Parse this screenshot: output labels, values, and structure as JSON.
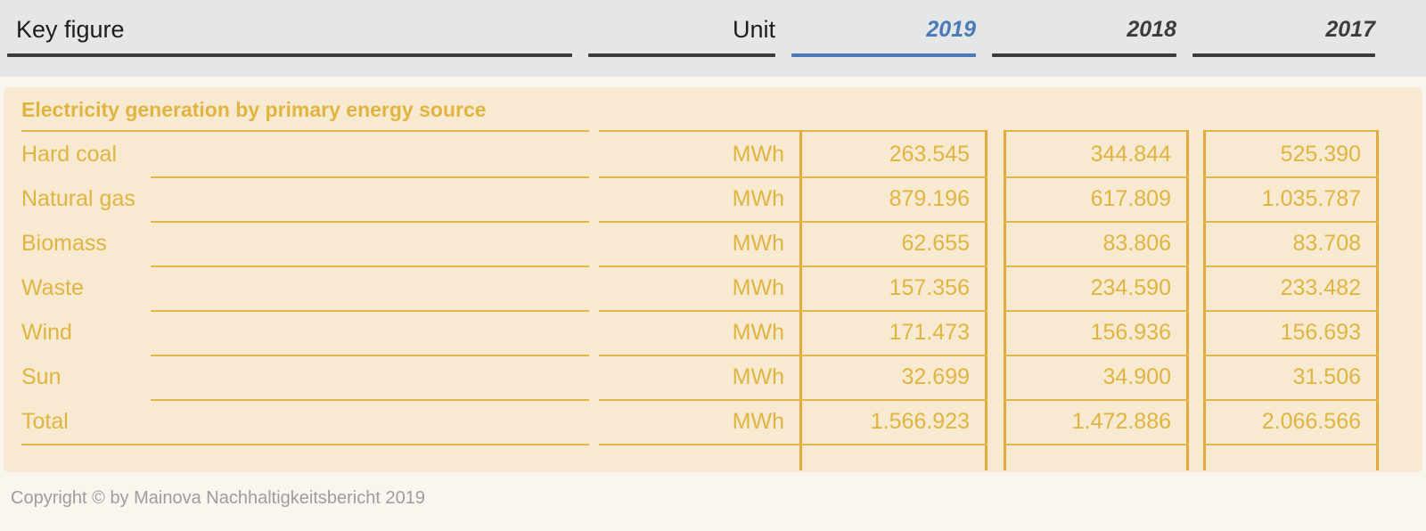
{
  "header": {
    "key_figure_label": "Key figure",
    "unit_label": "Unit",
    "years": [
      {
        "label": "2019",
        "active": true
      },
      {
        "label": "2018",
        "active": false
      },
      {
        "label": "2017",
        "active": false
      }
    ]
  },
  "section": {
    "title": "Electricity generation by primary energy source"
  },
  "table": {
    "columns": [
      "Key figure",
      "Unit",
      "2019",
      "2018",
      "2017"
    ],
    "rows": [
      {
        "label": "Hard coal",
        "unit": "MWh",
        "y2019": "263.545",
        "y2018": "344.844",
        "y2017": "525.390"
      },
      {
        "label": "Natural gas",
        "unit": "MWh",
        "y2019": "879.196",
        "y2018": "617.809",
        "y2017": "1.035.787"
      },
      {
        "label": "Biomass",
        "unit": "MWh",
        "y2019": "62.655",
        "y2018": "83.806",
        "y2017": "83.708"
      },
      {
        "label": "Waste",
        "unit": "MWh",
        "y2019": "157.356",
        "y2018": "234.590",
        "y2017": "233.482"
      },
      {
        "label": "Wind",
        "unit": "MWh",
        "y2019": "171.473",
        "y2018": "156.936",
        "y2017": "156.693"
      },
      {
        "label": "Sun",
        "unit": "MWh",
        "y2019": "32.699",
        "y2018": "34.900",
        "y2017": "31.506"
      },
      {
        "label": "Total",
        "unit": "MWh",
        "y2019": "1.566.923",
        "y2018": "1.472.886",
        "y2017": "2.066.566"
      }
    ]
  },
  "footer": {
    "copyright": "Copyright © by Mainova Nachhaltigkeitsbericht 2019"
  },
  "colors": {
    "header_background": "#e4e6e8",
    "page_background": "#faf6ef",
    "panel_background": "#f7ead0",
    "gold_text": "#e0b441",
    "gold_rule": "#e3b745",
    "active_year": "#4a7ab5",
    "header_rule": "#3c3c3b",
    "footer_text": "#9d9d9c"
  }
}
